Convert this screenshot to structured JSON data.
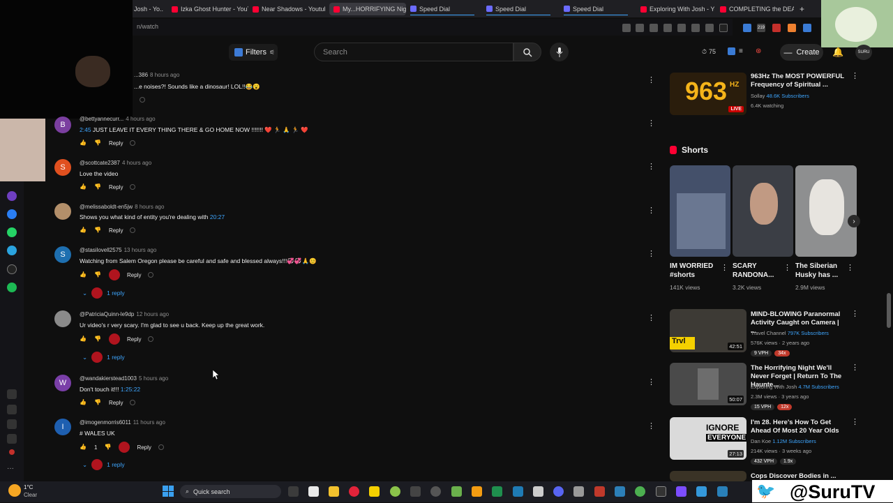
{
  "browser": {
    "tabs": [
      {
        "label": "Josh - Yo..."
      },
      {
        "label": "Izka Ghost Hunter - YouTu"
      },
      {
        "label": "Near Shadows - Youtube"
      },
      {
        "label": "My...HORRIFYING Night..."
      },
      {
        "label": "Speed Dial"
      },
      {
        "label": "Speed Dial"
      },
      {
        "label": "Speed Dial"
      },
      {
        "label": "Exploring With Josh - Yo"
      },
      {
        "label": "COMPLETING the DEATH"
      }
    ],
    "new_tab_label": "+",
    "url": "n/watch",
    "ext_badge": "219"
  },
  "header": {
    "filters_label": "Filters",
    "search_placeholder": "Search",
    "points": "75",
    "create_label": "Create",
    "avatar_label": "SURU"
  },
  "comments": [
    {
      "handle": "...386",
      "time": "8 hours ago",
      "text": "...e noises?! Sounds like a dinosaur! LOL!!😂😮",
      "likes": "",
      "reply": "Reply",
      "avatar": "",
      "avatar_color": "#555555"
    },
    {
      "handle": "@bettyannecurr...",
      "time": "4 hours ago",
      "time_link": "2:45",
      "text": " JUST LEAVE IT EVERY THING THERE & GO HOME NOW !!!!!!! ❤️ 🏃 🙏 🏃 ❤️",
      "reply": "Reply",
      "avatar": "B",
      "avatar_color": "#7b3fa0"
    },
    {
      "handle": "@scottcate2387",
      "time": "4 hours ago",
      "text": "Love the video",
      "reply": "Reply",
      "avatar": "S",
      "avatar_color": "#e0501f"
    },
    {
      "handle": "@melissaboldt-en5jw",
      "time": "8 hours ago",
      "text": "Shows you what kind of entity you're dealing with ",
      "text_link": "20:27",
      "reply": "Reply",
      "avatar": "",
      "avatar_color": "#b38f6a"
    },
    {
      "handle": "@stasilovell2575",
      "time": "13 hours ago",
      "text": "Watching from Salem Oregon please be careful and safe and blessed always!!!💞💞🙏😊",
      "reply": "Reply",
      "avatar": "S",
      "avatar_color": "#1e6fb0",
      "replies": "1 reply"
    },
    {
      "handle": "@PatriciaQuinn-le9dp",
      "time": "12 hours ago",
      "text": "Ur video's r very scary. I'm glad to see u back. Keep up the great work.",
      "reply": "Reply",
      "avatar": "",
      "avatar_color": "#8a8a8a",
      "replies": "1 reply"
    },
    {
      "handle": "@wandakierstead1003",
      "time": "5 hours ago",
      "text": "Don't touch it!!! ",
      "text_link": "1:25:22",
      "reply": "Reply",
      "avatar": "W",
      "avatar_color": "#7a3fa8"
    },
    {
      "handle": "@imogenmorris6011",
      "time": "11 hours ago",
      "text": "# WALES UK",
      "likes": "1",
      "reply": "Reply",
      "avatar": "I",
      "avatar_color": "#1e5fb0",
      "replies": "1 reply"
    }
  ],
  "right": {
    "live": {
      "title": "963Hz The MOST POWERFUL Frequency of Spiritual ...",
      "channel": "Sollay",
      "subs": "48.6K Subscribers",
      "meta": "6.4K watching",
      "thumb_text": "963",
      "thumb_sub": "HZ",
      "live_badge": "LIVE"
    },
    "shorts_heading": "Shorts",
    "shorts": [
      {
        "title": "IM WORRIED #shorts",
        "views": "141K views"
      },
      {
        "title": "SCARY RANDONA...",
        "views": "3.2K views"
      },
      {
        "title": "The Siberian Husky has ...",
        "views": "2.9M views"
      }
    ],
    "videos": [
      {
        "title": "MIND-BLOWING Paranormal Activity Caught on Camera | ...",
        "channel": "Travel Channel",
        "subs": "797K Subscribers",
        "meta": "576K views · 2 years ago",
        "pills": [
          "9 VPH",
          "34x"
        ],
        "duration": "42:51",
        "logo": "Trvl"
      },
      {
        "title": "The Horrifying Night We'll Never Forget | Return To The Haunte...",
        "channel": "Exploring With Josh",
        "subs": "4.7M Subscribers",
        "meta": "2.3M views · 3 years ago",
        "pills": [
          "15 VPH",
          "12x"
        ],
        "duration": "50:07"
      },
      {
        "title": "I'm 28. Here's How To Get Ahead Of Most 20 Year Olds",
        "channel": "Dan Koe",
        "subs": "1.12M Subscribers",
        "meta": "214K views · 3 weeks ago",
        "pills": [
          "432 VPH",
          "1.9x"
        ],
        "duration": "27:13",
        "thumb_line1": "IGNORE",
        "thumb_line2": "EVERYONE"
      },
      {
        "title": "Cops Discover Bodies in ..."
      }
    ]
  },
  "taskbar": {
    "weather_temp": "1°C",
    "weather_desc": "Clear",
    "search_label": "Quick search"
  },
  "overlay": {
    "handle": "@SuruTV"
  },
  "colors": {
    "bg": "#0f0f0f",
    "link": "#3ea6ff",
    "accent_red": "#ff0033"
  }
}
